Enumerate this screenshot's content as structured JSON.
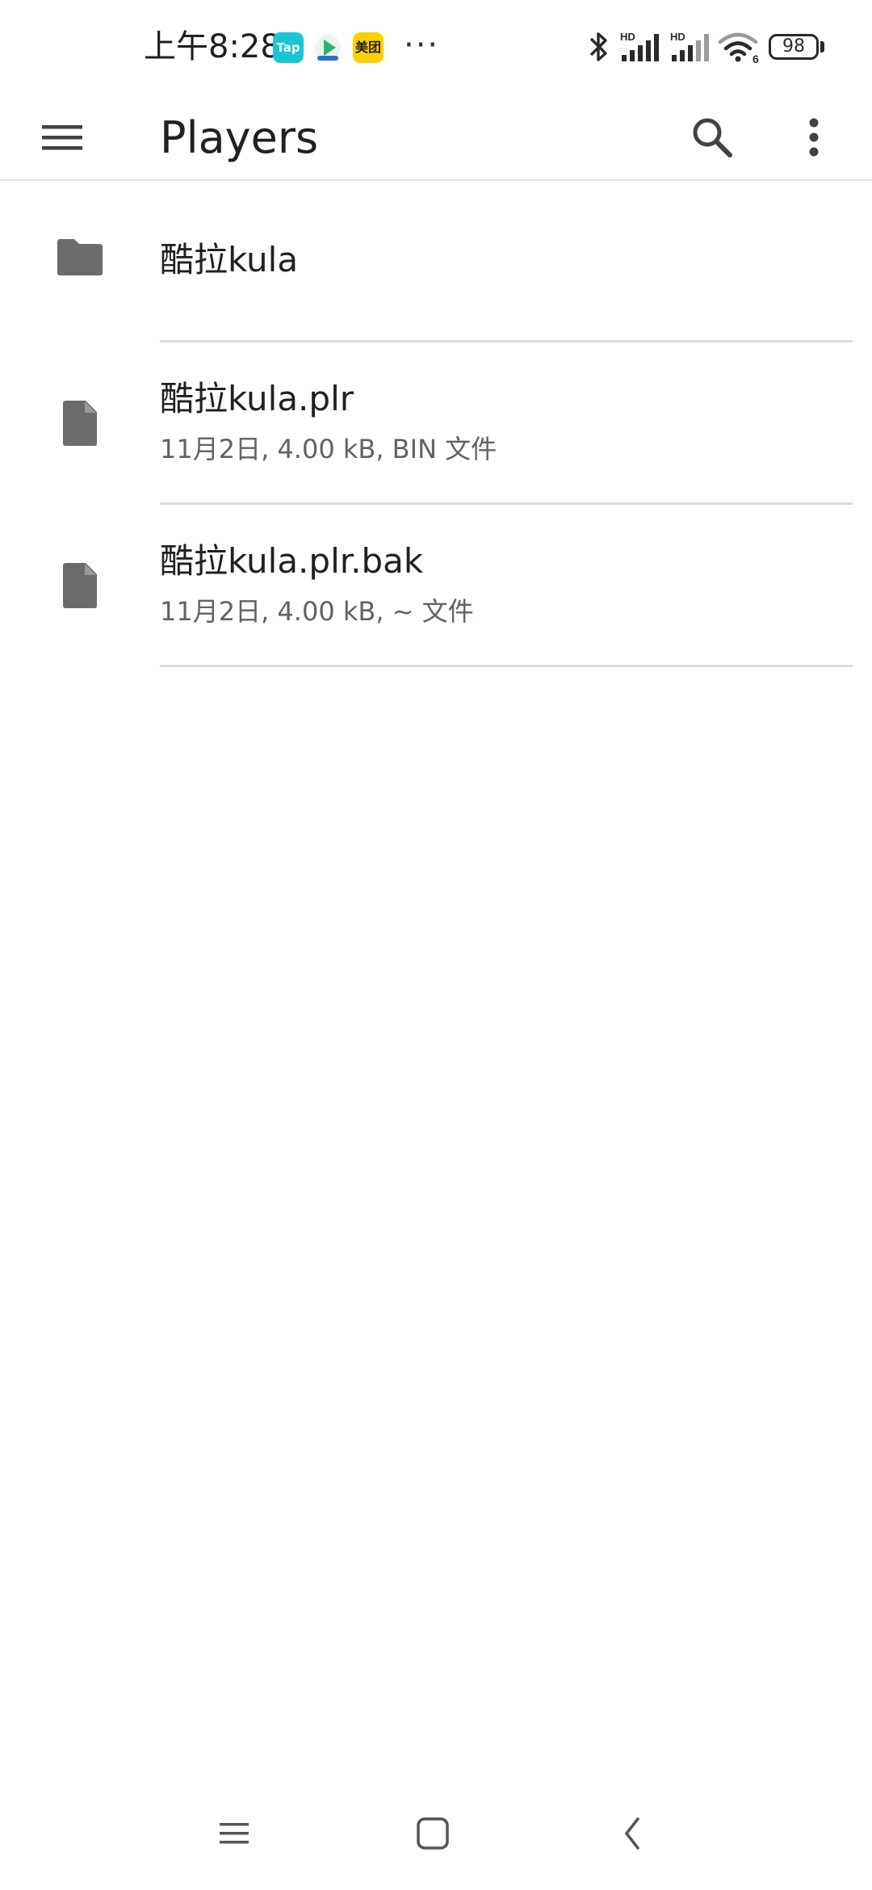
{
  "status_bar": {
    "time": "上午8:28",
    "notifications": [
      {
        "name": "tap-app-icon",
        "label": "Tap",
        "color": "#19c6d6"
      },
      {
        "name": "video-app-icon",
        "color": "#2ab46b"
      },
      {
        "name": "meituan-app-icon",
        "label": "美团",
        "color": "#ffd000"
      }
    ],
    "more_indicator": "···",
    "icons": [
      "bluetooth-icon",
      "signal-hd-icon",
      "signal-hd-icon",
      "wifi-icon"
    ],
    "signal_badge": "HD",
    "wifi_badge": "6",
    "battery_level": "98"
  },
  "app_bar": {
    "title": "Players",
    "icons": [
      "menu-icon",
      "search-icon",
      "more-vert-icon"
    ]
  },
  "files": [
    {
      "type": "folder",
      "name": "酷拉kula",
      "meta": "",
      "icon": "folder-icon"
    },
    {
      "type": "file",
      "name": "酷拉kula.plr",
      "meta": "11月2日, 4.00 kB, BIN 文件",
      "icon": "file-icon"
    },
    {
      "type": "file",
      "name": "酷拉kula.plr.bak",
      "meta": "11月2日, 4.00 kB, ~ 文件",
      "icon": "file-icon"
    }
  ],
  "nav_bar": {
    "icons": [
      "recents-icon",
      "home-icon",
      "back-icon"
    ]
  },
  "colors": {
    "icon_gray": "#6b6b6b",
    "text_primary": "#202124",
    "text_secondary": "#5f6368",
    "divider": "#dcdcdc"
  }
}
